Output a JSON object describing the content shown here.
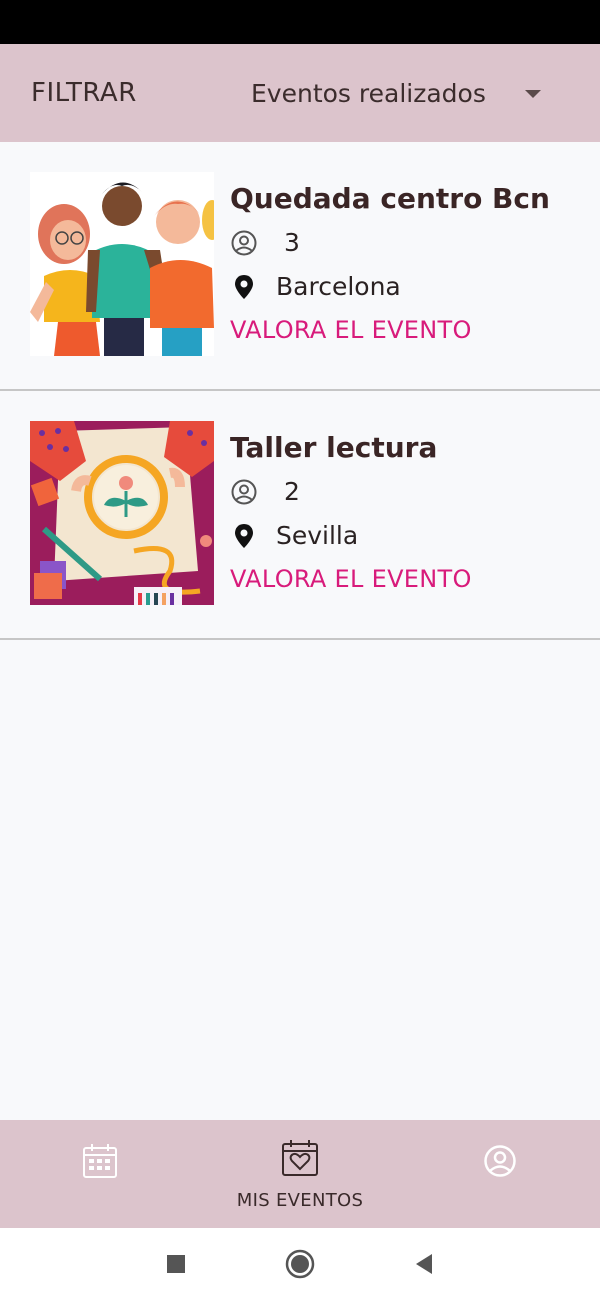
{
  "filter": {
    "label": "FILTRAR",
    "selected": "Eventos realizados"
  },
  "events": [
    {
      "title": "Quedada centro Bcn",
      "attendees": "3",
      "location": "Barcelona",
      "action": "VALORA EL EVENTO",
      "image": "friends-group-illustration"
    },
    {
      "title": "Taller lectura",
      "attendees": "2",
      "location": "Sevilla",
      "action": "VALORA EL EVENTO",
      "image": "embroidery-hoop-illustration"
    }
  ],
  "bottom_nav": {
    "items": [
      {
        "icon": "calendar-icon",
        "label": ""
      },
      {
        "icon": "calendar-heart-icon",
        "label": "MIS EVENTOS"
      },
      {
        "icon": "user-icon",
        "label": ""
      }
    ],
    "active_index": 1
  },
  "colors": {
    "bar_background": "#dcc4cc",
    "accent": "#d81b7b",
    "page_background": "#f8f9fb"
  }
}
